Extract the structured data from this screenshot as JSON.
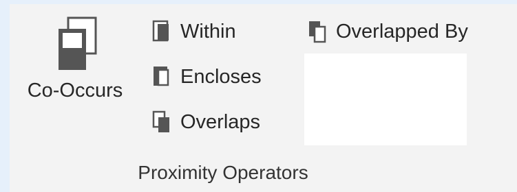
{
  "ribbon_group": {
    "title": "Proximity Operators",
    "buttons": {
      "co_occurs": {
        "label": "Co-Occurs",
        "icon": "co-occurs-icon"
      },
      "within": {
        "label": "Within",
        "icon": "within-icon"
      },
      "encloses": {
        "label": "Encloses",
        "icon": "encloses-icon"
      },
      "overlaps": {
        "label": "Overlaps",
        "icon": "overlaps-icon"
      },
      "overlapped_by": {
        "label": "Overlapped By",
        "icon": "overlapped-by-icon"
      }
    }
  },
  "colors": {
    "background": "#e6f0fb",
    "panel": "#f3f3f3",
    "icon_dark": "#555555",
    "icon_light": "#ffffff",
    "text": "#262626"
  }
}
